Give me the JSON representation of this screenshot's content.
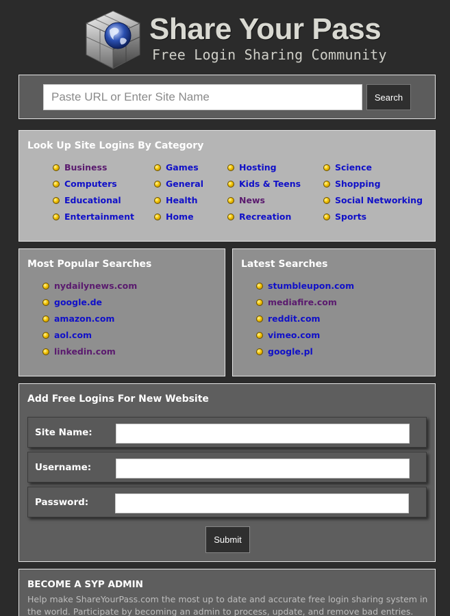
{
  "header": {
    "title": "Share Your Pass",
    "tagline": "Free Login Sharing Community"
  },
  "search": {
    "placeholder": "Paste URL or Enter Site Name",
    "button_label": "Search"
  },
  "categories": {
    "title": "Look Up Site Logins By Category",
    "items": [
      {
        "label": "Business",
        "visited": true
      },
      {
        "label": "Computers",
        "visited": false
      },
      {
        "label": "Educational",
        "visited": false
      },
      {
        "label": "Entertainment",
        "visited": false
      },
      {
        "label": "Games",
        "visited": false
      },
      {
        "label": "General",
        "visited": false
      },
      {
        "label": "Health",
        "visited": false
      },
      {
        "label": "Home",
        "visited": false
      },
      {
        "label": "Hosting",
        "visited": false
      },
      {
        "label": "Kids & Teens",
        "visited": false
      },
      {
        "label": "News",
        "visited": true
      },
      {
        "label": "Recreation",
        "visited": false
      },
      {
        "label": "Science",
        "visited": false
      },
      {
        "label": "Shopping",
        "visited": false
      },
      {
        "label": "Social Networking",
        "visited": false
      },
      {
        "label": "Sports",
        "visited": false
      }
    ]
  },
  "popular": {
    "title": "Most Popular Searches",
    "items": [
      {
        "label": "nydailynews.com",
        "visited": true
      },
      {
        "label": "google.de",
        "visited": false
      },
      {
        "label": "amazon.com",
        "visited": false
      },
      {
        "label": "aol.com",
        "visited": false
      },
      {
        "label": "linkedin.com",
        "visited": true
      }
    ]
  },
  "latest": {
    "title": "Latest Searches",
    "items": [
      {
        "label": "stumbleupon.com",
        "visited": false
      },
      {
        "label": "mediafire.com",
        "visited": true
      },
      {
        "label": "reddit.com",
        "visited": false
      },
      {
        "label": "vimeo.com",
        "visited": false
      },
      {
        "label": "google.pl",
        "visited": false
      }
    ]
  },
  "add_logins": {
    "title": "Add Free Logins For New Website",
    "site_name_label": "Site Name:",
    "username_label": "Username:",
    "password_label": "Password:",
    "site_name_value": "",
    "username_value": "",
    "password_value": "",
    "submit_label": "Submit"
  },
  "admin": {
    "title": "BECOME A SYP ADMIN",
    "text": "Help make ShareYourPass.com the most up to date and accurate free login sharing system in the world. Participate by becoming an admin to process, update, and remove bad entries."
  },
  "colors": {
    "link": "#1010c8",
    "link_visited": "#5a1a6e",
    "bullet": "#f2c200"
  }
}
